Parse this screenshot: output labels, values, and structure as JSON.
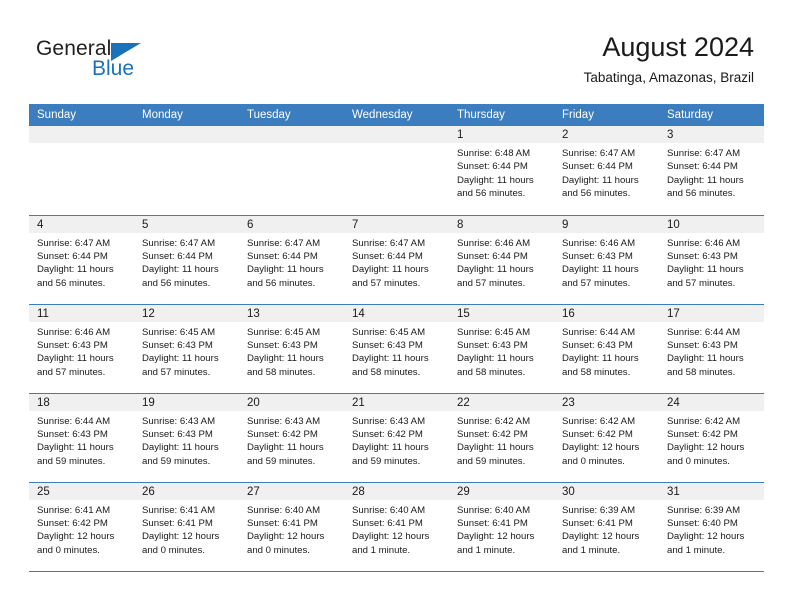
{
  "brand": {
    "name_part1": "General",
    "name_part2": "Blue",
    "triangle_color": "#1a72ba"
  },
  "header": {
    "title": "August 2024",
    "subtitle": "Tabatinga, Amazonas, Brazil"
  },
  "theme": {
    "header_row_bg": "#3b7dbf",
    "daynum_band_bg": "#f0f0f0",
    "grid_line": "#3b7dbf",
    "text": "#1a1a1a"
  },
  "weekday_headers": [
    "Sunday",
    "Monday",
    "Tuesday",
    "Wednesday",
    "Thursday",
    "Friday",
    "Saturday"
  ],
  "weeks": [
    [
      {
        "day": "",
        "empty": true,
        "sunrise": "",
        "sunset": "",
        "daylight": ""
      },
      {
        "day": "",
        "empty": true,
        "sunrise": "",
        "sunset": "",
        "daylight": ""
      },
      {
        "day": "",
        "empty": true,
        "sunrise": "",
        "sunset": "",
        "daylight": ""
      },
      {
        "day": "",
        "empty": true,
        "sunrise": "",
        "sunset": "",
        "daylight": ""
      },
      {
        "day": "1",
        "empty": false,
        "sunrise": "Sunrise: 6:48 AM",
        "sunset": "Sunset: 6:44 PM",
        "daylight": "Daylight: 11 hours and 56 minutes."
      },
      {
        "day": "2",
        "empty": false,
        "sunrise": "Sunrise: 6:47 AM",
        "sunset": "Sunset: 6:44 PM",
        "daylight": "Daylight: 11 hours and 56 minutes."
      },
      {
        "day": "3",
        "empty": false,
        "sunrise": "Sunrise: 6:47 AM",
        "sunset": "Sunset: 6:44 PM",
        "daylight": "Daylight: 11 hours and 56 minutes."
      }
    ],
    [
      {
        "day": "4",
        "empty": false,
        "sunrise": "Sunrise: 6:47 AM",
        "sunset": "Sunset: 6:44 PM",
        "daylight": "Daylight: 11 hours and 56 minutes."
      },
      {
        "day": "5",
        "empty": false,
        "sunrise": "Sunrise: 6:47 AM",
        "sunset": "Sunset: 6:44 PM",
        "daylight": "Daylight: 11 hours and 56 minutes."
      },
      {
        "day": "6",
        "empty": false,
        "sunrise": "Sunrise: 6:47 AM",
        "sunset": "Sunset: 6:44 PM",
        "daylight": "Daylight: 11 hours and 56 minutes."
      },
      {
        "day": "7",
        "empty": false,
        "sunrise": "Sunrise: 6:47 AM",
        "sunset": "Sunset: 6:44 PM",
        "daylight": "Daylight: 11 hours and 57 minutes."
      },
      {
        "day": "8",
        "empty": false,
        "sunrise": "Sunrise: 6:46 AM",
        "sunset": "Sunset: 6:44 PM",
        "daylight": "Daylight: 11 hours and 57 minutes."
      },
      {
        "day": "9",
        "empty": false,
        "sunrise": "Sunrise: 6:46 AM",
        "sunset": "Sunset: 6:43 PM",
        "daylight": "Daylight: 11 hours and 57 minutes."
      },
      {
        "day": "10",
        "empty": false,
        "sunrise": "Sunrise: 6:46 AM",
        "sunset": "Sunset: 6:43 PM",
        "daylight": "Daylight: 11 hours and 57 minutes."
      }
    ],
    [
      {
        "day": "11",
        "empty": false,
        "sunrise": "Sunrise: 6:46 AM",
        "sunset": "Sunset: 6:43 PM",
        "daylight": "Daylight: 11 hours and 57 minutes."
      },
      {
        "day": "12",
        "empty": false,
        "sunrise": "Sunrise: 6:45 AM",
        "sunset": "Sunset: 6:43 PM",
        "daylight": "Daylight: 11 hours and 57 minutes."
      },
      {
        "day": "13",
        "empty": false,
        "sunrise": "Sunrise: 6:45 AM",
        "sunset": "Sunset: 6:43 PM",
        "daylight": "Daylight: 11 hours and 58 minutes."
      },
      {
        "day": "14",
        "empty": false,
        "sunrise": "Sunrise: 6:45 AM",
        "sunset": "Sunset: 6:43 PM",
        "daylight": "Daylight: 11 hours and 58 minutes."
      },
      {
        "day": "15",
        "empty": false,
        "sunrise": "Sunrise: 6:45 AM",
        "sunset": "Sunset: 6:43 PM",
        "daylight": "Daylight: 11 hours and 58 minutes."
      },
      {
        "day": "16",
        "empty": false,
        "sunrise": "Sunrise: 6:44 AM",
        "sunset": "Sunset: 6:43 PM",
        "daylight": "Daylight: 11 hours and 58 minutes."
      },
      {
        "day": "17",
        "empty": false,
        "sunrise": "Sunrise: 6:44 AM",
        "sunset": "Sunset: 6:43 PM",
        "daylight": "Daylight: 11 hours and 58 minutes."
      }
    ],
    [
      {
        "day": "18",
        "empty": false,
        "sunrise": "Sunrise: 6:44 AM",
        "sunset": "Sunset: 6:43 PM",
        "daylight": "Daylight: 11 hours and 59 minutes."
      },
      {
        "day": "19",
        "empty": false,
        "sunrise": "Sunrise: 6:43 AM",
        "sunset": "Sunset: 6:43 PM",
        "daylight": "Daylight: 11 hours and 59 minutes."
      },
      {
        "day": "20",
        "empty": false,
        "sunrise": "Sunrise: 6:43 AM",
        "sunset": "Sunset: 6:42 PM",
        "daylight": "Daylight: 11 hours and 59 minutes."
      },
      {
        "day": "21",
        "empty": false,
        "sunrise": "Sunrise: 6:43 AM",
        "sunset": "Sunset: 6:42 PM",
        "daylight": "Daylight: 11 hours and 59 minutes."
      },
      {
        "day": "22",
        "empty": false,
        "sunrise": "Sunrise: 6:42 AM",
        "sunset": "Sunset: 6:42 PM",
        "daylight": "Daylight: 11 hours and 59 minutes."
      },
      {
        "day": "23",
        "empty": false,
        "sunrise": "Sunrise: 6:42 AM",
        "sunset": "Sunset: 6:42 PM",
        "daylight": "Daylight: 12 hours and 0 minutes."
      },
      {
        "day": "24",
        "empty": false,
        "sunrise": "Sunrise: 6:42 AM",
        "sunset": "Sunset: 6:42 PM",
        "daylight": "Daylight: 12 hours and 0 minutes."
      }
    ],
    [
      {
        "day": "25",
        "empty": false,
        "sunrise": "Sunrise: 6:41 AM",
        "sunset": "Sunset: 6:42 PM",
        "daylight": "Daylight: 12 hours and 0 minutes."
      },
      {
        "day": "26",
        "empty": false,
        "sunrise": "Sunrise: 6:41 AM",
        "sunset": "Sunset: 6:41 PM",
        "daylight": "Daylight: 12 hours and 0 minutes."
      },
      {
        "day": "27",
        "empty": false,
        "sunrise": "Sunrise: 6:40 AM",
        "sunset": "Sunset: 6:41 PM",
        "daylight": "Daylight: 12 hours and 0 minutes."
      },
      {
        "day": "28",
        "empty": false,
        "sunrise": "Sunrise: 6:40 AM",
        "sunset": "Sunset: 6:41 PM",
        "daylight": "Daylight: 12 hours and 1 minute."
      },
      {
        "day": "29",
        "empty": false,
        "sunrise": "Sunrise: 6:40 AM",
        "sunset": "Sunset: 6:41 PM",
        "daylight": "Daylight: 12 hours and 1 minute."
      },
      {
        "day": "30",
        "empty": false,
        "sunrise": "Sunrise: 6:39 AM",
        "sunset": "Sunset: 6:41 PM",
        "daylight": "Daylight: 12 hours and 1 minute."
      },
      {
        "day": "31",
        "empty": false,
        "sunrise": "Sunrise: 6:39 AM",
        "sunset": "Sunset: 6:40 PM",
        "daylight": "Daylight: 12 hours and 1 minute."
      }
    ]
  ]
}
